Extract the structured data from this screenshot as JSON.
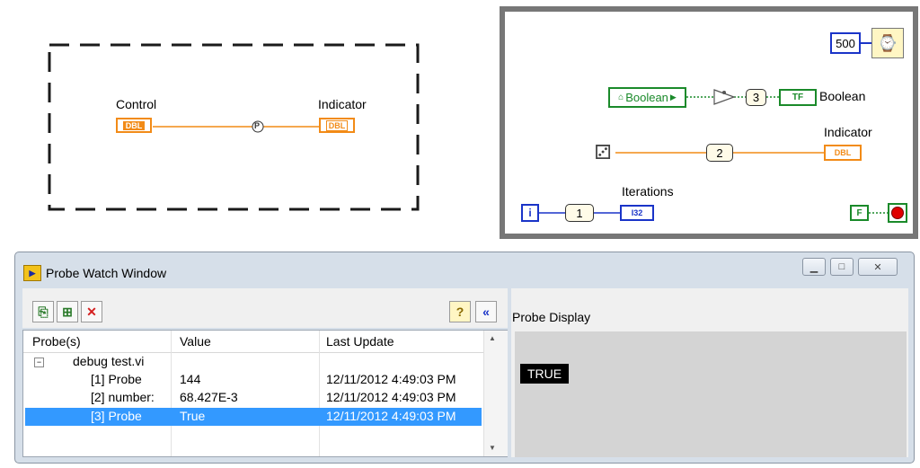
{
  "diagram_left": {
    "control_label": "Control",
    "control_type": "DBL",
    "indicator_label": "Indicator",
    "indicator_type": "DBL",
    "probe_marker": "P"
  },
  "diagram_right": {
    "wait_value": "500",
    "boolean_local": "Boolean",
    "probe3": "3",
    "bool_indicator_type": "TF",
    "bool_indicator_label": "Boolean",
    "probe2": "2",
    "indicator_label": "Indicator",
    "indicator_type": "DBL",
    "iteration_terminal": "i",
    "probe1": "1",
    "iterations_label": "Iterations",
    "iterations_type": "I32",
    "false_const": "F"
  },
  "probe_window": {
    "title": "Probe Watch Window",
    "columns": [
      "Probe(s)",
      "Value",
      "Last Update"
    ],
    "tree_root": "debug test.vi",
    "rows": [
      {
        "probe": "[1] Probe",
        "value": "144",
        "updated": "12/11/2012 4:49:03 PM",
        "selected": false
      },
      {
        "probe": "[2] number:",
        "value": "68.427E-3",
        "updated": "12/11/2012 4:49:03 PM",
        "selected": false
      },
      {
        "probe": "[3] Probe",
        "value": "True",
        "updated": "12/11/2012 4:49:03 PM",
        "selected": true
      }
    ],
    "display_title": "Probe Display",
    "display_value": "TRUE"
  },
  "colors": {
    "dbl_orange": "#f28b17",
    "bool_green": "#1a8a2a",
    "int_blue": "#1a34c8",
    "selection": "#3399ff"
  }
}
